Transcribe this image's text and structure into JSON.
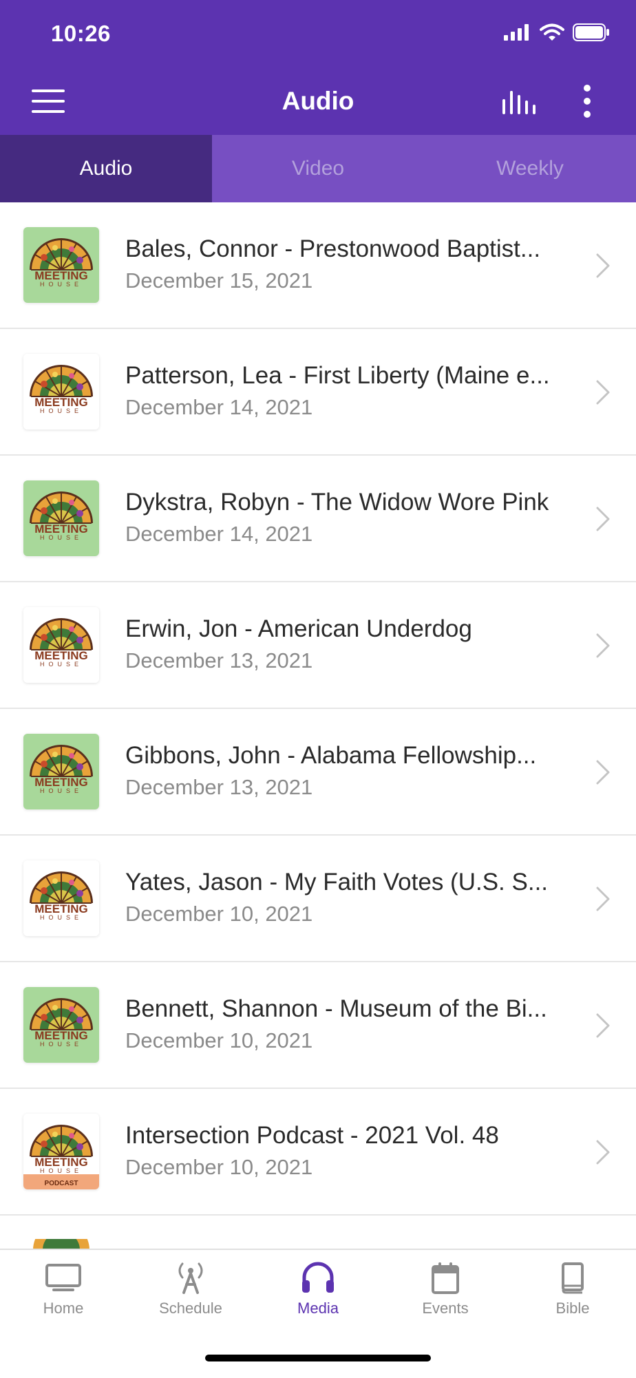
{
  "status": {
    "time": "10:26"
  },
  "header": {
    "title": "Audio"
  },
  "tabs": [
    {
      "label": "Audio",
      "active": true
    },
    {
      "label": "Video",
      "active": false
    },
    {
      "label": "Weekly",
      "active": false
    }
  ],
  "list": [
    {
      "title": "Bales, Connor - Prestonwood Baptist...",
      "date": "December 15, 2021",
      "thumb_bg": "#a8d89a",
      "podcast": false
    },
    {
      "title": "Patterson, Lea - First Liberty (Maine e...",
      "date": "December 14, 2021",
      "thumb_bg": "#ffffff",
      "podcast": false
    },
    {
      "title": "Dykstra, Robyn - The Widow Wore Pink",
      "date": "December 14, 2021",
      "thumb_bg": "#a8d89a",
      "podcast": false
    },
    {
      "title": "Erwin, Jon - American Underdog",
      "date": "December 13, 2021",
      "thumb_bg": "#ffffff",
      "podcast": false
    },
    {
      "title": "Gibbons, John - Alabama Fellowship...",
      "date": "December 13, 2021",
      "thumb_bg": "#a8d89a",
      "podcast": false
    },
    {
      "title": "Yates, Jason - My Faith Votes (U.S. S...",
      "date": "December 10, 2021",
      "thumb_bg": "#ffffff",
      "podcast": false
    },
    {
      "title": "Bennett, Shannon - Museum of the Bi...",
      "date": "December 10, 2021",
      "thumb_bg": "#a8d89a",
      "podcast": false
    },
    {
      "title": "Intersection Podcast - 2021 Vol. 48",
      "date": "December 10, 2021",
      "thumb_bg": "#ffffff",
      "podcast": true,
      "podcast_label": "PODCAST"
    }
  ],
  "thumbnail_text": {
    "line1": "MEETING",
    "line2": "HOUSE"
  },
  "tabbar": [
    {
      "label": "Home",
      "icon": "monitor-icon",
      "active": false
    },
    {
      "label": "Schedule",
      "icon": "antenna-icon",
      "active": false
    },
    {
      "label": "Media",
      "icon": "headphones-icon",
      "active": true
    },
    {
      "label": "Events",
      "icon": "calendar-icon",
      "active": false
    },
    {
      "label": "Bible",
      "icon": "book-icon",
      "active": false
    }
  ],
  "colors": {
    "primary": "#5c33b0",
    "tab_active": "#452a80",
    "tab_inactive": "#774fc2",
    "green_thumb": "#a8d89a"
  }
}
